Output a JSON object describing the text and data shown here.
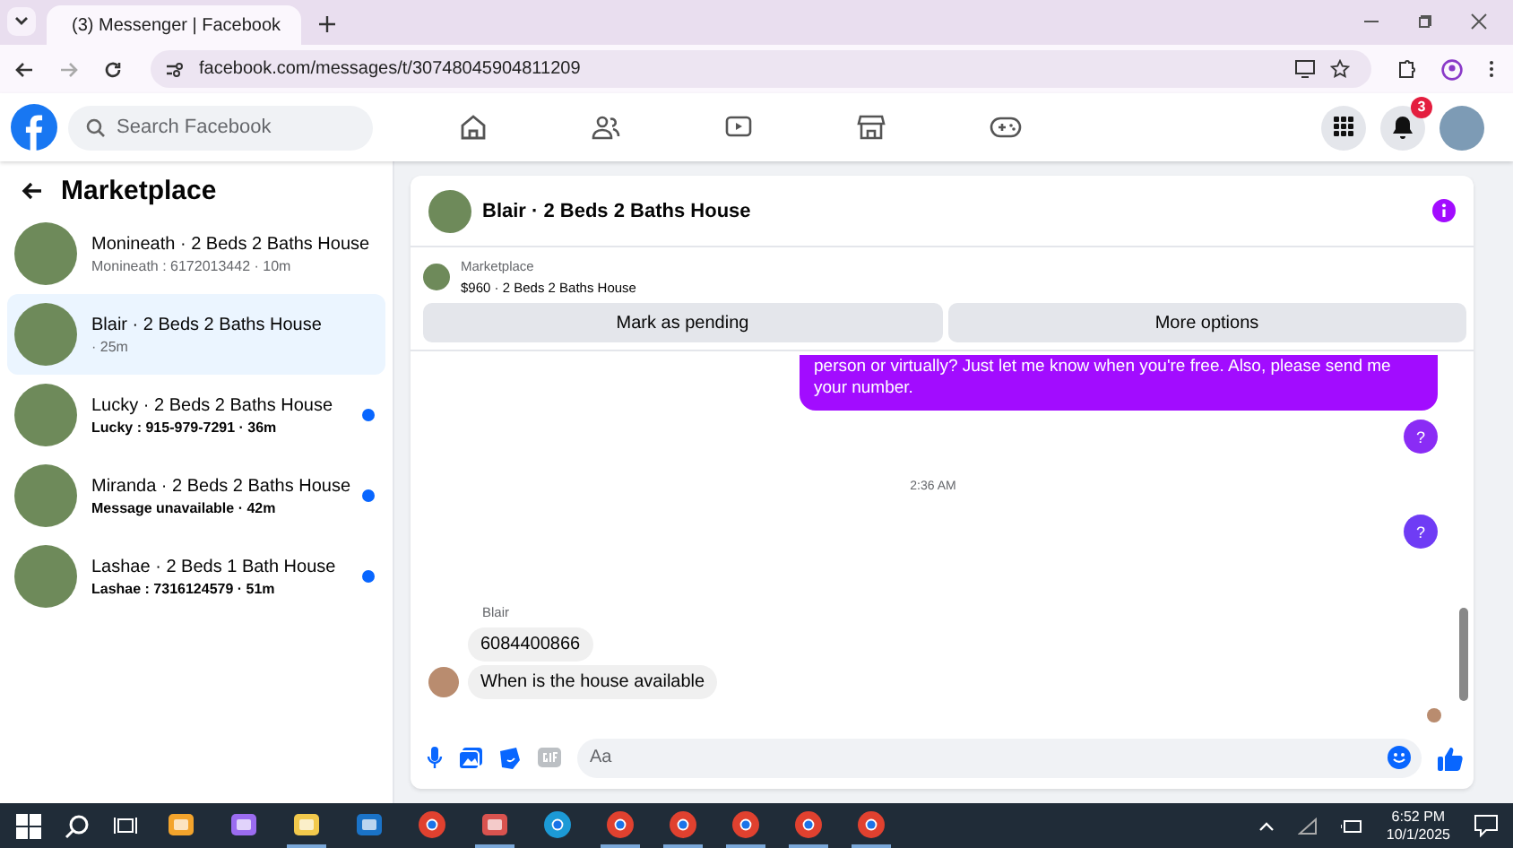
{
  "browser": {
    "tab_title": "(3) Messenger | Facebook",
    "url": "facebook.com/messages/t/30748045904811209"
  },
  "header": {
    "search": {
      "placeholder": "Search Facebook"
    },
    "notification_count": "3"
  },
  "sidebar": {
    "title": "Marketplace",
    "conversations": [
      {
        "title": "Monineath · 2 Beds 2 Baths House",
        "subtitle": "Monineath : 6172013442",
        "time": " · 10m",
        "unread": false,
        "selected": false
      },
      {
        "title": "Blair · 2 Beds 2 Baths House",
        "time": " · 25m",
        "unread": false,
        "selected": true
      },
      {
        "title": "Lucky · 2 Beds 2 Baths House",
        "subtitle": "Lucky : 915-979-7291",
        "time": " · 36m",
        "unread": true,
        "selected": false
      },
      {
        "title": "Miranda · 2 Beds 2 Baths House",
        "subtitle": "Message unavailable",
        "time": " · 42m",
        "unread": true,
        "selected": false
      },
      {
        "title": "Lashae · 2 Beds 1 Bath House",
        "subtitle": "Lashae : 7316124579",
        "time": " · 51m",
        "unread": true,
        "selected": false
      }
    ]
  },
  "chat": {
    "title": "Blair · 2 Beds 2 Baths House",
    "listing": {
      "source": "Marketplace",
      "summary": "$960 · 2 Beds 2 Baths House"
    },
    "actions": [
      "Mark as pending",
      "More options"
    ],
    "messages": [
      {
        "kind": "outgoing",
        "text": "person or virtually? Just let me know when you're free. Also, please send me your number.",
        "color": "#a20cff"
      },
      {
        "kind": "outgoing",
        "text": "?",
        "color": "#8a2cf5"
      },
      {
        "kind": "timestamp",
        "text": "2:36 AM"
      },
      {
        "kind": "outgoing",
        "text": "?",
        "color": "#6f3cf5"
      },
      {
        "kind": "sender",
        "text": "Blair"
      },
      {
        "kind": "incoming",
        "text": "6084400866",
        "avatar": false
      },
      {
        "kind": "incoming",
        "text": "When is the house available",
        "avatar": true
      }
    ],
    "composer": {
      "placeholder": "Aa"
    }
  },
  "taskbar": {
    "time": "6:52 PM",
    "date": "10/1/2025",
    "apps": [
      {
        "kind": "store",
        "running": false
      },
      {
        "kind": "copilot",
        "running": false
      },
      {
        "kind": "folder",
        "running": true
      },
      {
        "kind": "outlook",
        "running": false
      },
      {
        "kind": "chrome",
        "running": false
      },
      {
        "kind": "paint",
        "running": true
      },
      {
        "kind": "edge",
        "running": false
      },
      {
        "kind": "chrome",
        "running": true
      },
      {
        "kind": "chrome",
        "running": true
      },
      {
        "kind": "chrome",
        "running": true
      },
      {
        "kind": "chrome",
        "running": true
      },
      {
        "kind": "chrome",
        "running": true
      }
    ]
  }
}
